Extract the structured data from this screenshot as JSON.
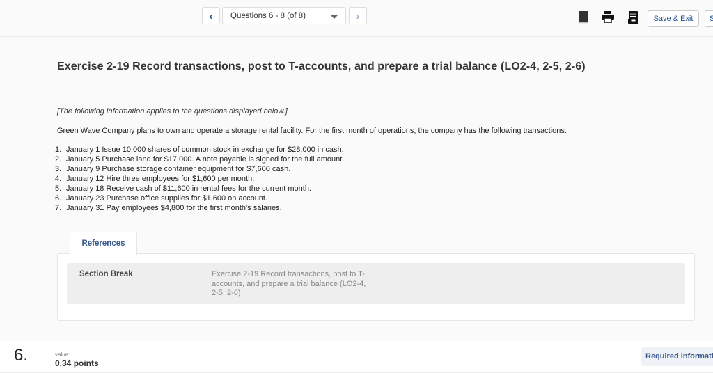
{
  "header": {
    "prev_label": "<",
    "next_label": ">",
    "question_selector": "Questions 6 - 8 (of 8)",
    "icons": [
      "book-icon",
      "print-icon",
      "archive-icon"
    ],
    "save_exit_label": "Save & Exit",
    "edge_button_label": "S"
  },
  "exercise": {
    "title": "Exercise 2-19 Record transactions, post to T-accounts, and prepare a trial balance (LO2-4, 2-5, 2-6)",
    "intro_note": "[The following information applies to the questions displayed below.]",
    "description": "Green Wave Company plans to own and operate a storage rental facility. For the first month of operations, the company has the following transactions.",
    "transactions": [
      {
        "num": "1.",
        "text": "January 1 Issue 10,000 shares of common stock in exchange for $28,000 in cash."
      },
      {
        "num": "2.",
        "text": "January 5 Purchase land for $17,000. A note payable is signed for the full amount."
      },
      {
        "num": "3.",
        "text": "January 9 Purchase storage container equipment for $7,600 cash."
      },
      {
        "num": "4.",
        "text": "January 12 Hire three employees for $1,600 per month."
      },
      {
        "num": "5.",
        "text": "January 18 Receive cash of $11,600 in rental fees for the current month."
      },
      {
        "num": "6.",
        "text": "January 23 Purchase office supplies for $1,600 on account."
      },
      {
        "num": "7.",
        "text": "January 31 Pay employees $4,800 for the first month's salaries."
      }
    ]
  },
  "references": {
    "tab_label": "References",
    "section_label": "Section Break",
    "section_desc": "Exercise 2-19 Record transactions, post to T-accounts, and prepare a trial balance (LO2-4, 2-5, 2-6)"
  },
  "question": {
    "number": "6.",
    "value_label": "value:",
    "points": "0.34 points",
    "required_info_label": "Required information"
  },
  "colors": {
    "accent": "#1d4f91",
    "background": "#fafafa"
  }
}
